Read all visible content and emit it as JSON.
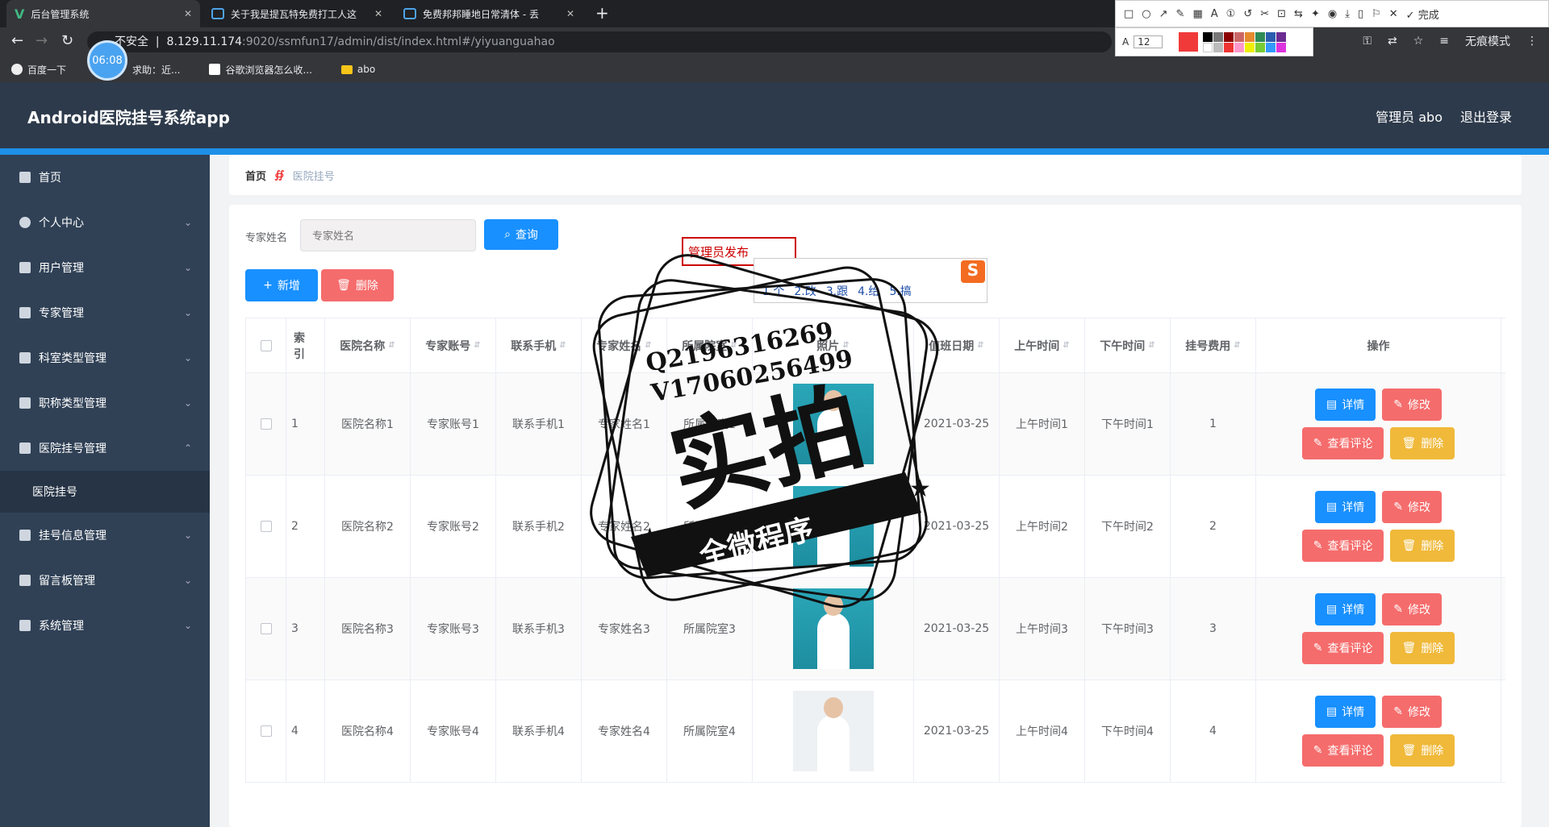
{
  "browser": {
    "tabs": [
      {
        "title": "后台管理系统",
        "active": true
      },
      {
        "title": "关于我是提瓦特免费打工人这"
      },
      {
        "title": "免费邦邦睡地日常清体 - 丢"
      }
    ],
    "url_prefix": "不安全",
    "url_host": "8.129.11.174",
    "url_rest": ":9020/ssmfun17/admin/dist/index.html#/yiyuanguahao",
    "timer": "06:08",
    "bookmarks": [
      "百度一下",
      "求助：近...",
      "谷歌浏览器怎么收...",
      "abo"
    ],
    "right_label": "无痕模式",
    "anno_done": "完成",
    "anno_font_size": "12"
  },
  "header": {
    "title": "Android医院挂号系统app",
    "user": "管理员 abo",
    "logout": "退出登录"
  },
  "sidebar": {
    "items": [
      {
        "label": "首页"
      },
      {
        "label": "个人中心"
      },
      {
        "label": "用户管理"
      },
      {
        "label": "专家管理"
      },
      {
        "label": "科室类型管理"
      },
      {
        "label": "职称类型管理"
      },
      {
        "label": "医院挂号管理"
      },
      {
        "label": "医院挂号"
      },
      {
        "label": "挂号信息管理"
      },
      {
        "label": "留言板管理"
      },
      {
        "label": "系统管理"
      }
    ]
  },
  "breadcrumb": {
    "home": "首页",
    "current": "医院挂号"
  },
  "search": {
    "label": "专家姓名",
    "placeholder": "专家姓名",
    "button": "查询"
  },
  "actions": {
    "add": "新增",
    "delete": "删除"
  },
  "table": {
    "headers": [
      "索引",
      "医院名称",
      "专家账号",
      "联系手机",
      "专家姓名",
      "所属院室",
      "照片",
      "值班日期",
      "上午时间",
      "下午时间",
      "挂号费用",
      "操作"
    ],
    "rows": [
      [
        "1",
        "医院名称1",
        "专家账号1",
        "联系手机1",
        "专家姓名1",
        "所属院室1",
        "2021-03-25",
        "上午时间1",
        "下午时间1",
        "1"
      ],
      [
        "2",
        "医院名称2",
        "专家账号2",
        "联系手机2",
        "专家姓名2",
        "所属院室2",
        "2021-03-25",
        "上午时间2",
        "下午时间2",
        "2"
      ],
      [
        "3",
        "医院名称3",
        "专家账号3",
        "联系手机3",
        "专家姓名3",
        "所属院室3",
        "2021-03-25",
        "上午时间3",
        "下午时间3",
        "3"
      ],
      [
        "4",
        "医院名称4",
        "专家账号4",
        "联系手机4",
        "专家姓名4",
        "所属院室4",
        "2021-03-25",
        "上午时间4",
        "下午时间4",
        "4"
      ]
    ],
    "op_labels": {
      "detail": "详情",
      "edit": "修改",
      "review": "查看评论",
      "delete": "删除"
    }
  },
  "ime": {
    "input": "管理员发布",
    "candidates": [
      "1.个",
      "2.改",
      "3.跟",
      "4.给",
      "5.搞"
    ]
  },
  "watermark": {
    "line1": "Q2196316269",
    "line2": "V17060256499",
    "big": "实拍",
    "banner": "全微程序"
  }
}
